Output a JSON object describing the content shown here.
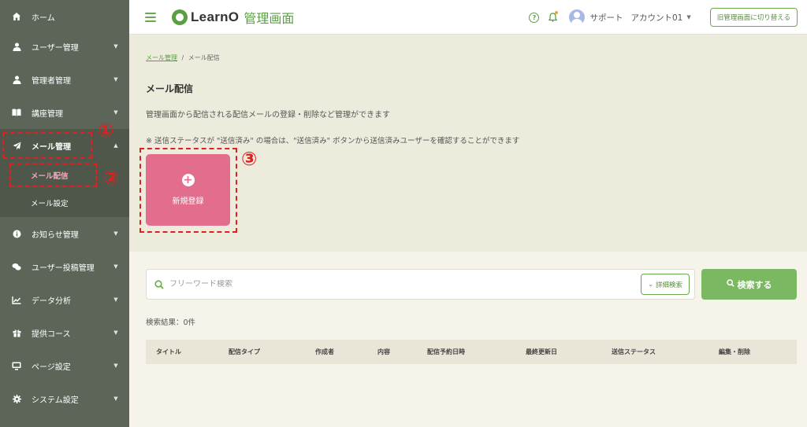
{
  "sidebar": {
    "items": [
      {
        "label": "ホーム",
        "icon": "home-icon"
      },
      {
        "label": "ユーザー管理",
        "icon": "user-icon"
      },
      {
        "label": "管理者管理",
        "icon": "admin-icon"
      },
      {
        "label": "講座管理",
        "icon": "book-icon"
      },
      {
        "label": "メール管理",
        "icon": "paper-plane-icon"
      },
      {
        "label": "お知らせ管理",
        "icon": "info-icon"
      },
      {
        "label": "ユーザー投稿管理",
        "icon": "chat-icon"
      },
      {
        "label": "データ分析",
        "icon": "line-chart-icon"
      },
      {
        "label": "提供コース",
        "icon": "gift-icon"
      },
      {
        "label": "ページ設定",
        "icon": "monitor-icon"
      },
      {
        "label": "システム設定",
        "icon": "gear-icon"
      }
    ],
    "sub_items": [
      {
        "label": "メール配信"
      },
      {
        "label": "メール設定"
      }
    ]
  },
  "header": {
    "logo": "LearnO",
    "subtitle": "管理画面",
    "support": "サポート",
    "account": "アカウント01",
    "old_button": "旧管理画面に切り替える"
  },
  "breadcrumb": {
    "parent": "メール管理",
    "separator": "/",
    "current": "メール配信"
  },
  "page": {
    "title": "メール配信",
    "description": "管理画面から配信される配信メールの登録・削除など管理ができます",
    "note": "※ 送信ステータスが \"送信済み\" の場合は、\"送信済み\" ボタンから送信済みユーザーを確認することができます",
    "new_button": "新規登録"
  },
  "annotations": {
    "one": "①",
    "two": "②",
    "three": "③",
    "color": "#e0201f"
  },
  "search": {
    "placeholder": "フリーワード検索",
    "value": "",
    "detail_button": "詳細検索",
    "submit_button": "検索する",
    "result": "検索結果：0件"
  },
  "table": {
    "columns": [
      "タイトル",
      "配信タイプ",
      "作成者",
      "内容",
      "配信予約日時",
      "最終更新日",
      "送信ステータス",
      "編集・削除"
    ]
  },
  "colors": {
    "sidebar": "#5c6558",
    "accent_green": "#5aa043",
    "new_button_pink": "#e26d8d"
  }
}
